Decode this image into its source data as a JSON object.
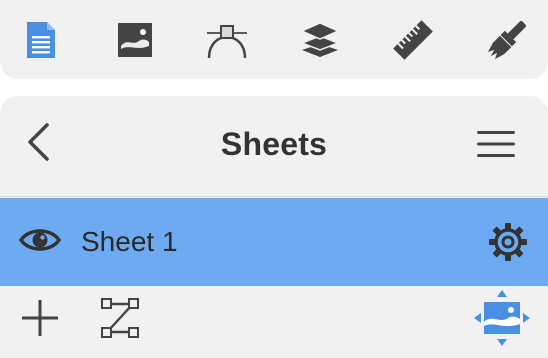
{
  "toolbar": {
    "tools": [
      {
        "name": "document-tool",
        "icon": "document-icon",
        "active": true
      },
      {
        "name": "image-tool",
        "icon": "image-icon",
        "active": false
      },
      {
        "name": "bezier-tool",
        "icon": "bezier-curve-icon",
        "active": false
      },
      {
        "name": "layers-tool",
        "icon": "layers-icon",
        "active": false
      },
      {
        "name": "ruler-tool",
        "icon": "ruler-icon",
        "active": false
      },
      {
        "name": "brush-tool",
        "icon": "paintbrush-icon",
        "active": false
      }
    ]
  },
  "panel": {
    "title": "Sheets",
    "back_icon": "chevron-left-icon",
    "menu_icon": "hamburger-menu-icon"
  },
  "sheets": [
    {
      "label": "Sheet 1",
      "visible": true,
      "selected": true
    }
  ],
  "bottom_bar": {
    "add_icon": "plus-icon",
    "connect_icon": "path-nodes-icon",
    "move_image_icon": "image-move-arrows-icon"
  },
  "colors": {
    "accent": "#4a90e2",
    "selection": "#6eaaf2",
    "icon": "#444444",
    "background": "#f1f1f2"
  }
}
